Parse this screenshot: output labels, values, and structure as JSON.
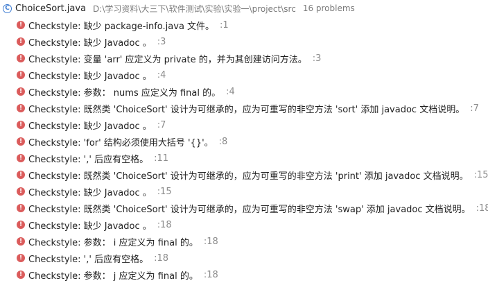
{
  "file": {
    "icon": "class-icon",
    "icon_glyph": "C",
    "name": "ChoiceSort.java",
    "path": "D:\\学习资料\\大三下\\软件测试\\实验\\实验一\\project\\src",
    "count": "16 problems"
  },
  "colors": {
    "error": "#db5c5c",
    "class_icon": "#3f7dd3",
    "muted": "#8c8c8c"
  },
  "problems": [
    {
      "icon": "error-icon",
      "message": "Checkstyle: 缺少 package-info.java 文件。",
      "line": ":1"
    },
    {
      "icon": "error-icon",
      "message": "Checkstyle: 缺少 Javadoc 。",
      "line": ":3"
    },
    {
      "icon": "error-icon",
      "message": "Checkstyle: 变量 'arr' 应定义为 private 的，并为其创建访问方法。",
      "line": ":3"
    },
    {
      "icon": "error-icon",
      "message": "Checkstyle: 缺少 Javadoc 。",
      "line": ":4"
    },
    {
      "icon": "error-icon",
      "message": "Checkstyle: 参数： nums 应定义为 final 的。",
      "line": ":4"
    },
    {
      "icon": "error-icon",
      "message": "Checkstyle: 既然类 'ChoiceSort' 设计为可继承的，应为可重写的非空方法 'sort' 添加 javadoc 文档说明。",
      "line": ":7"
    },
    {
      "icon": "error-icon",
      "message": "Checkstyle: 缺少 Javadoc 。",
      "line": ":7"
    },
    {
      "icon": "error-icon",
      "message": "Checkstyle: 'for' 结构必须使用大括号 '{}'。",
      "line": ":8"
    },
    {
      "icon": "error-icon",
      "message": "Checkstyle: ',' 后应有空格。",
      "line": ":11"
    },
    {
      "icon": "error-icon",
      "message": "Checkstyle: 既然类 'ChoiceSort' 设计为可继承的，应为可重写的非空方法 'print' 添加 javadoc 文档说明。",
      "line": ":15"
    },
    {
      "icon": "error-icon",
      "message": "Checkstyle: 缺少 Javadoc 。",
      "line": ":15"
    },
    {
      "icon": "error-icon",
      "message": "Checkstyle: 既然类 'ChoiceSort' 设计为可继承的，应为可重写的非空方法 'swap' 添加 javadoc 文档说明。",
      "line": ":18"
    },
    {
      "icon": "error-icon",
      "message": "Checkstyle: 缺少 Javadoc 。",
      "line": ":18"
    },
    {
      "icon": "error-icon",
      "message": "Checkstyle: 参数： i 应定义为 final 的。",
      "line": ":18"
    },
    {
      "icon": "error-icon",
      "message": "Checkstyle: ',' 后应有空格。",
      "line": ":18"
    },
    {
      "icon": "error-icon",
      "message": "Checkstyle: 参数： j 应定义为 final 的。",
      "line": ":18"
    }
  ]
}
